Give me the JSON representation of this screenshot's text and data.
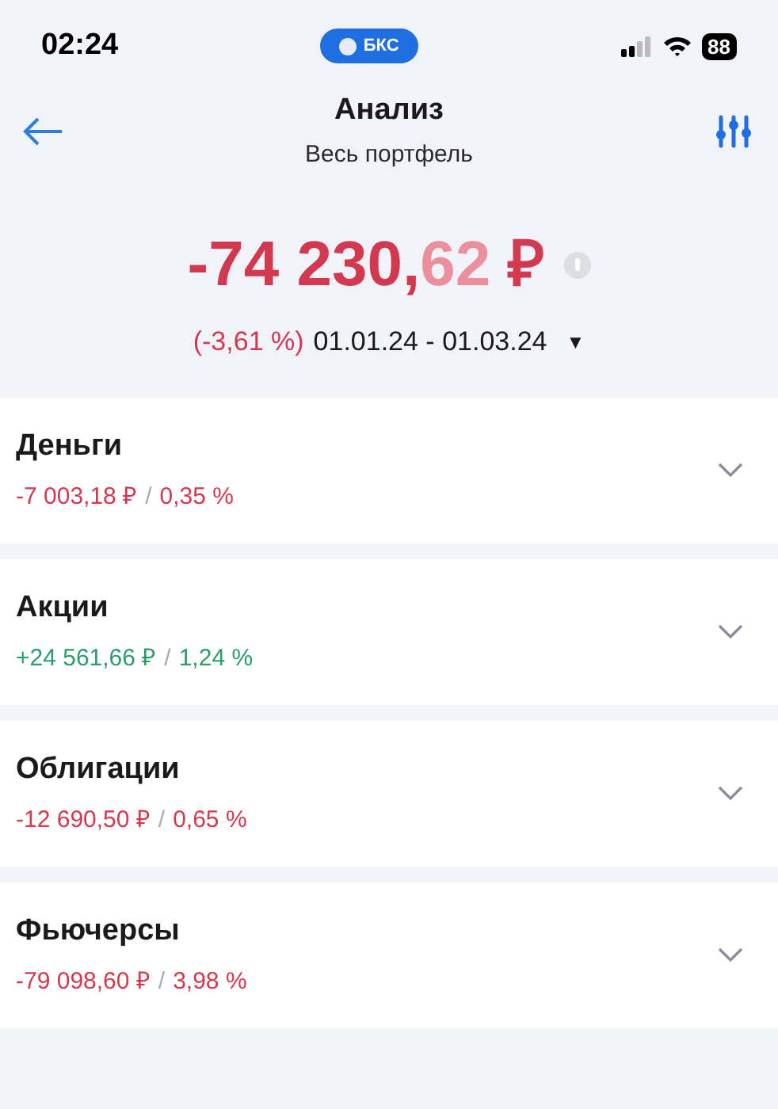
{
  "status_bar": {
    "time": "02:24",
    "app_pill": "БКС",
    "battery": "88"
  },
  "header": {
    "title": "Анализ",
    "subtitle": "Весь портфель"
  },
  "total": {
    "whole": "-74 230,",
    "fraction": "62",
    "currency": "₽",
    "kind": "loss",
    "change": "(-3,61 %)",
    "period": "01.01.24 - 01.03.24",
    "period_caret": "▼"
  },
  "categories": [
    {
      "name": "Деньги",
      "amount": "-7 003,18 ₽",
      "separator": "/",
      "share": "0,35 %",
      "kind": "loss",
      "expanded": false
    },
    {
      "name": "Акции",
      "amount": "+24 561,66 ₽",
      "separator": "/",
      "share": "1,24 %",
      "kind": "gain",
      "expanded": false
    },
    {
      "name": "Облигации",
      "amount": "-12 690,50 ₽",
      "separator": "/",
      "share": "0,65 %",
      "kind": "loss",
      "expanded": false
    },
    {
      "name": "Фьючерсы",
      "amount": "-79 098,60 ₽",
      "separator": "/",
      "share": "3,98 %",
      "kind": "loss",
      "expanded": false
    }
  ]
}
